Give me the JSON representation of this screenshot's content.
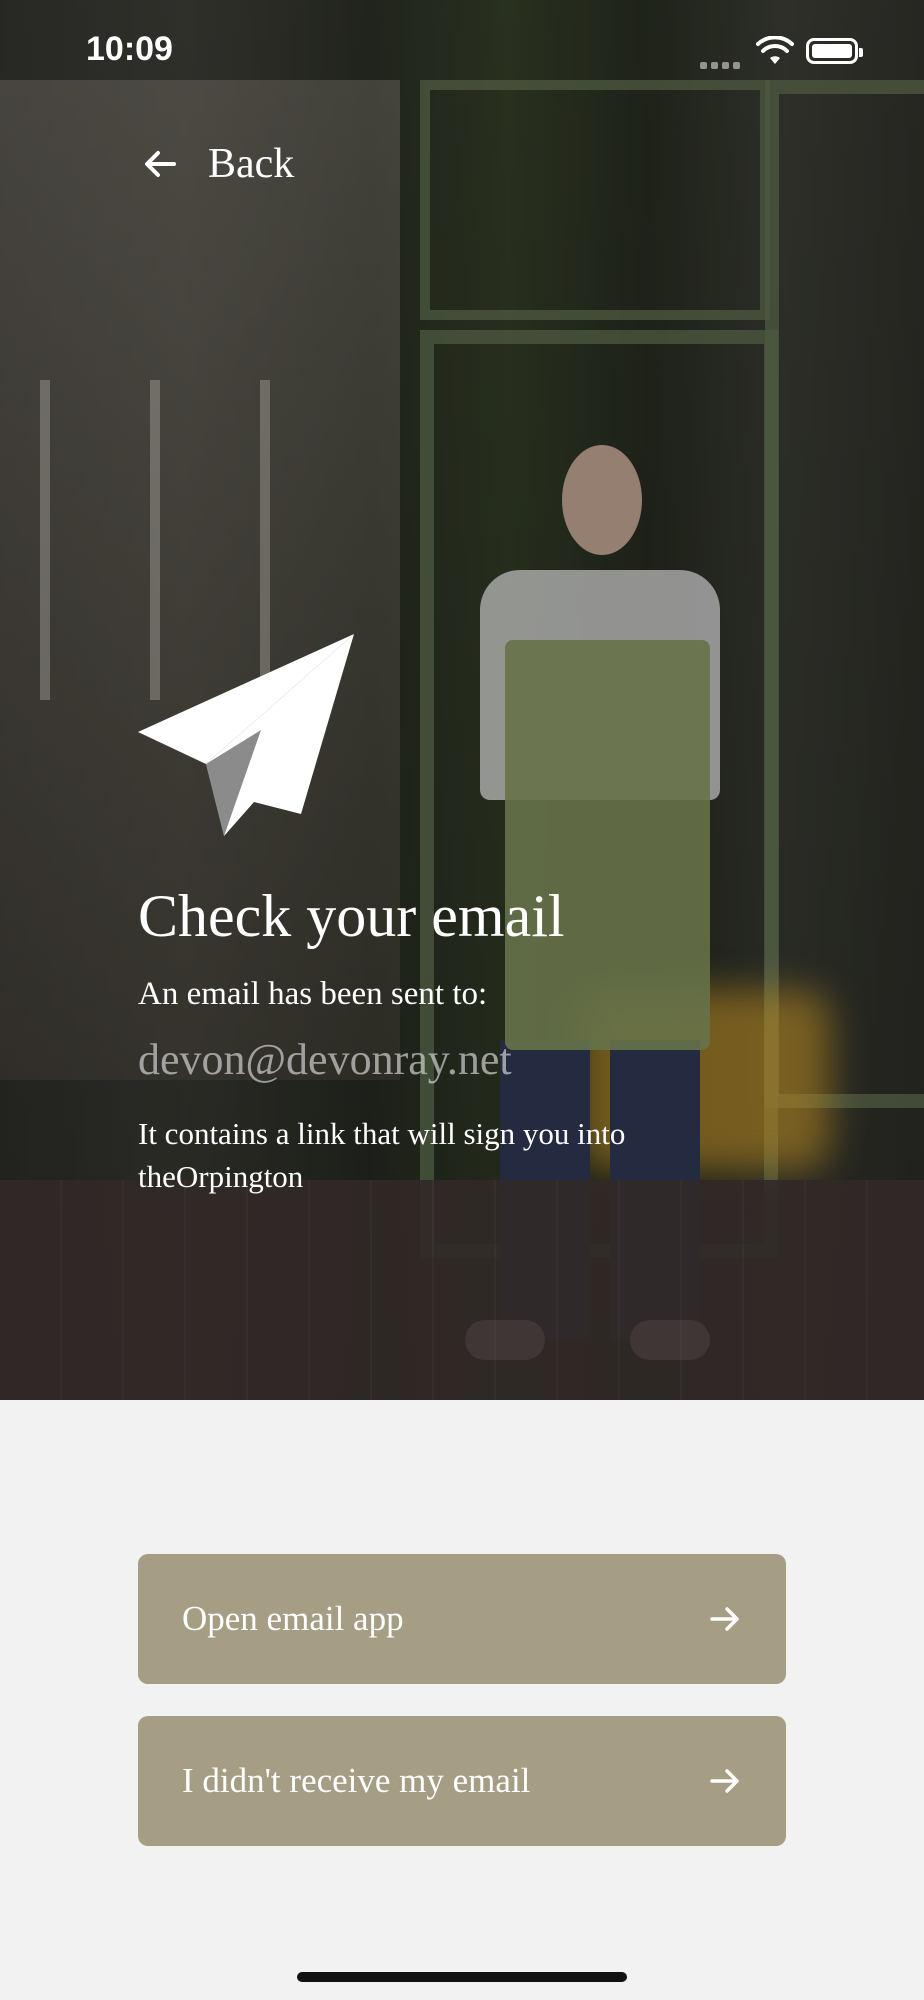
{
  "status_bar": {
    "time": "10:09"
  },
  "nav": {
    "back_label": "Back"
  },
  "content": {
    "title": "Check your email",
    "sent_to_label": "An email has been sent to:",
    "email": "devon@devonray.net",
    "description": "It contains a link that will sign you into theOrpington"
  },
  "actions": {
    "open_email_label": "Open email app",
    "not_received_label": "I didn't receive my email"
  },
  "colors": {
    "button_bg": "#a59d84",
    "page_bg": "#f2f2f2",
    "text_on_dark": "#ffffff"
  },
  "icons": {
    "back": "arrow-left-icon",
    "hero": "paper-plane-icon",
    "button": "arrow-right-icon"
  }
}
